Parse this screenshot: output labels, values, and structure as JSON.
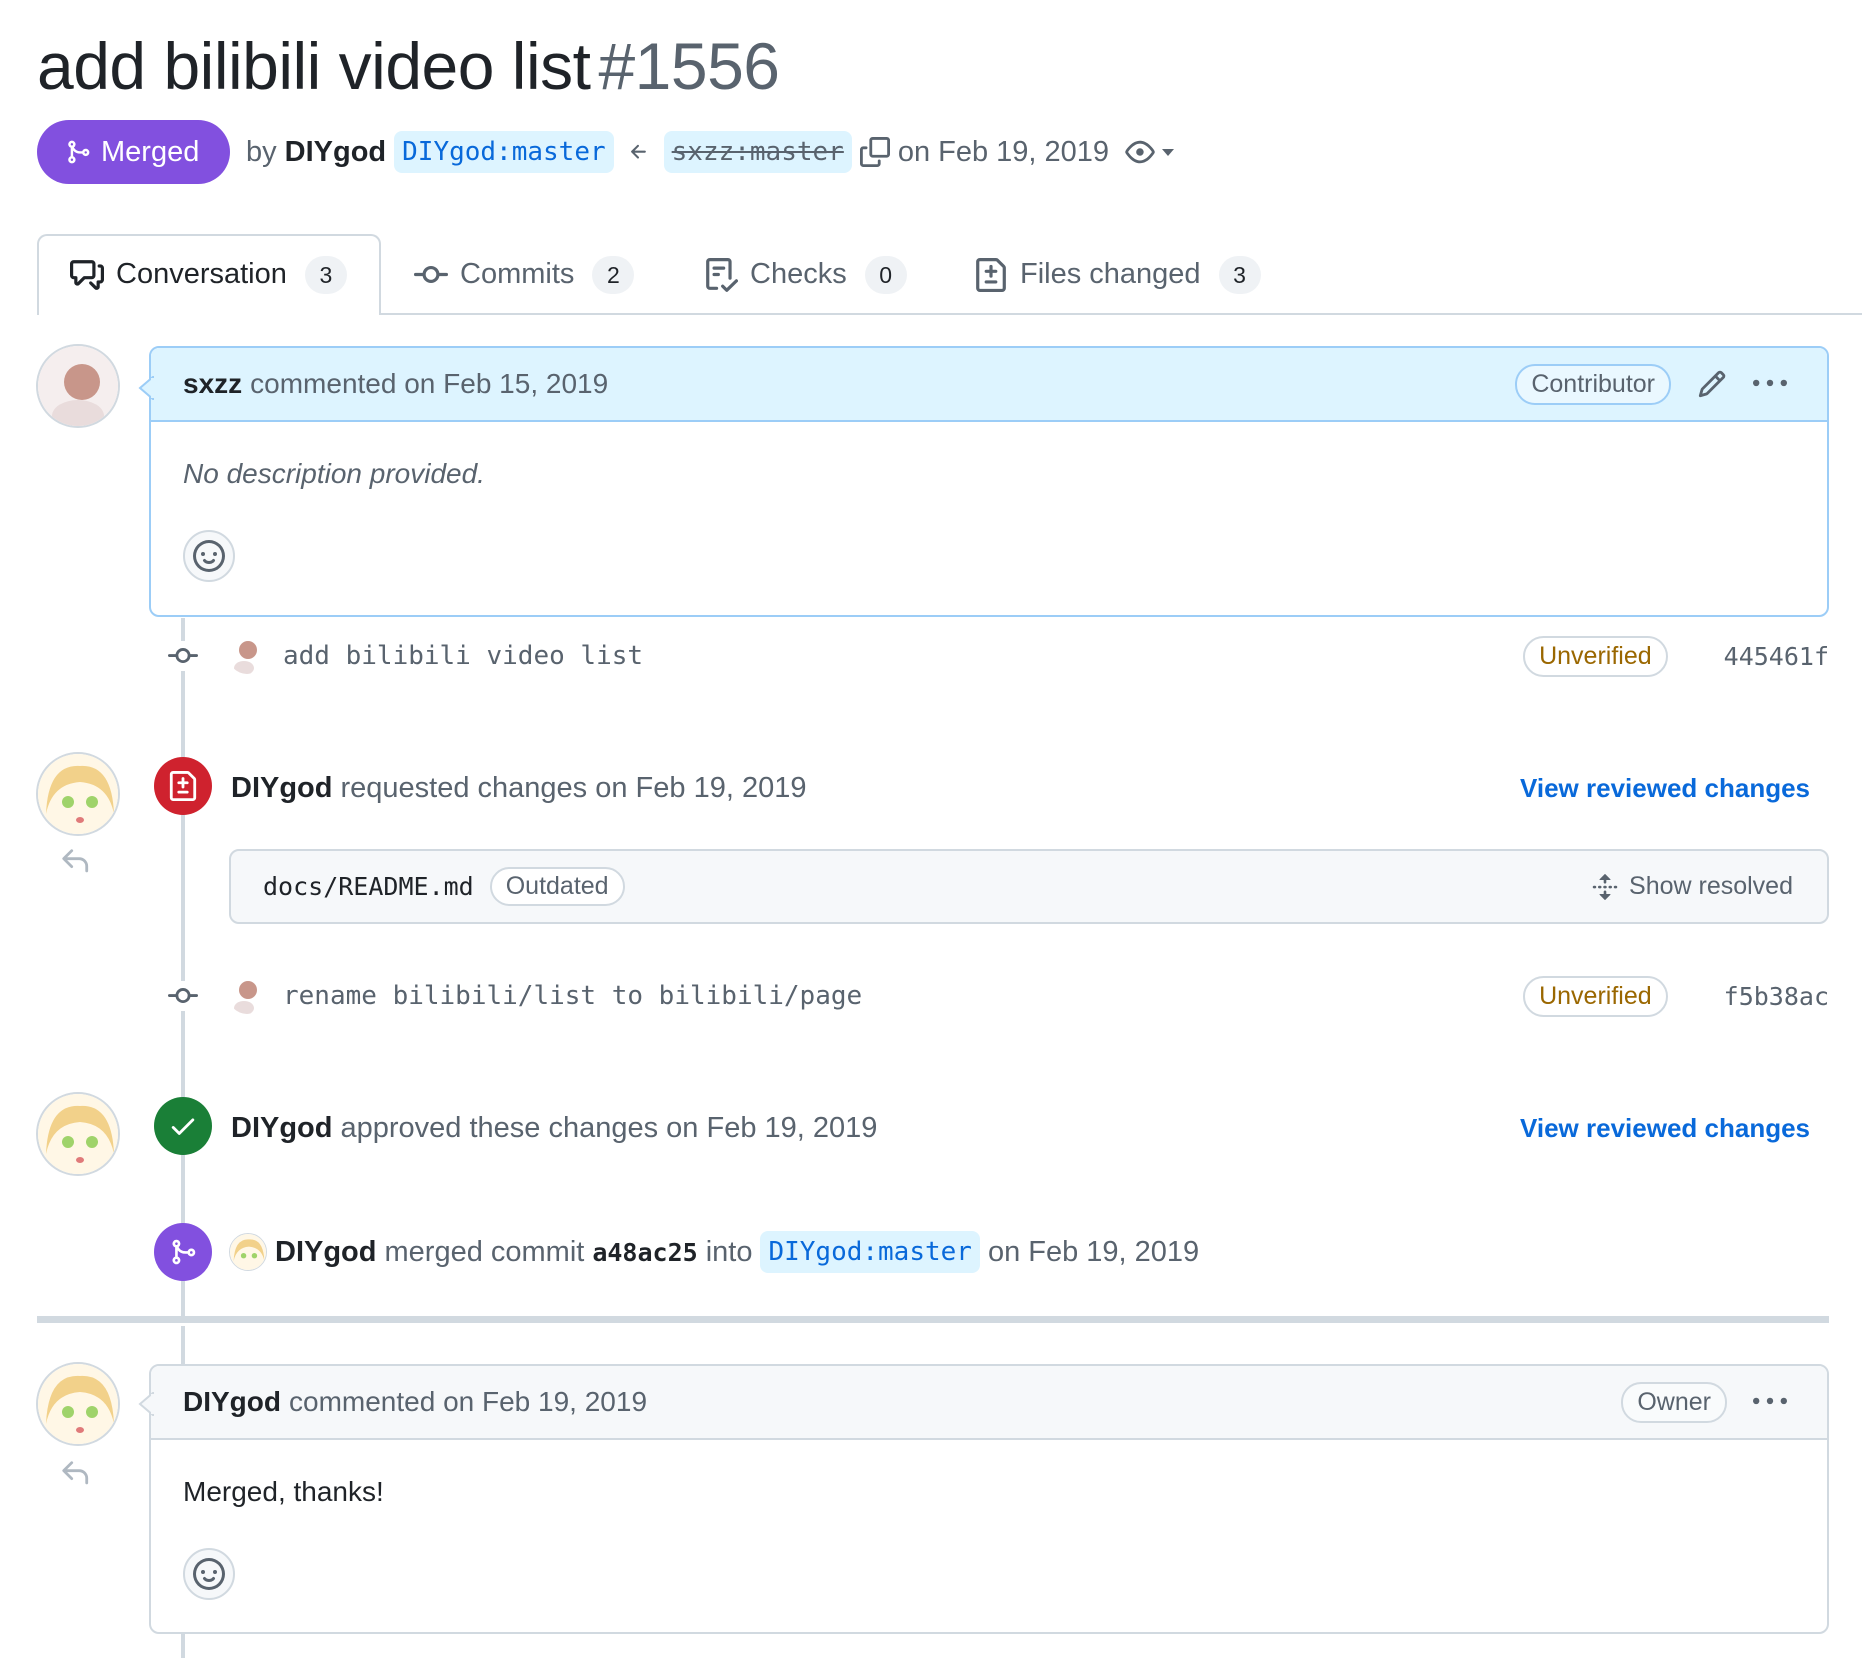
{
  "pr": {
    "title": "add bilibili video list",
    "number": "#1556",
    "state": "Merged",
    "by_prefix": "by",
    "author": "DIYgod",
    "base_ref": "DIYgod:master",
    "head_ref": "sxzz:master",
    "date_text": "on Feb 19, 2019"
  },
  "tabs": [
    {
      "label": "Conversation",
      "count": "3",
      "icon": "comment-discussion-icon"
    },
    {
      "label": "Commits",
      "count": "2",
      "icon": "git-commit-icon"
    },
    {
      "label": "Checks",
      "count": "0",
      "icon": "checklist-icon"
    },
    {
      "label": "Files changed",
      "count": "3",
      "icon": "file-diff-icon"
    }
  ],
  "timeline": {
    "comment1": {
      "author": "sxzz",
      "action": "commented on Feb 15, 2019",
      "role": "Contributor",
      "body": "No description provided."
    },
    "commit1": {
      "message": "add bilibili video list",
      "status": "Unverified",
      "sha": "445461f"
    },
    "review1": {
      "author": "DIYgod",
      "action": "requested changes on Feb 19, 2019",
      "link": "View reviewed changes",
      "file": "docs/README.md",
      "file_badge": "Outdated",
      "show_resolved": "Show resolved"
    },
    "commit2": {
      "message": "rename bilibili/list to bilibili/page",
      "status": "Unverified",
      "sha": "f5b38ac"
    },
    "review2": {
      "author": "DIYgod",
      "action": "approved these changes on Feb 19, 2019",
      "link": "View reviewed changes"
    },
    "merge": {
      "author": "DIYgod",
      "action": "merged commit",
      "commit": "a48ac25",
      "into": "into",
      "ref": "DIYgod:master",
      "date": "on Feb 19, 2019"
    },
    "comment2": {
      "author": "DIYgod",
      "action": "commented on Feb 19, 2019",
      "role": "Owner",
      "body": "Merged, thanks!"
    }
  },
  "colors": {
    "merged": "#8250df",
    "changes_requested": "#cf222e",
    "approved": "#1a7f37",
    "link": "#0969da",
    "unverified": "#9a6700"
  }
}
